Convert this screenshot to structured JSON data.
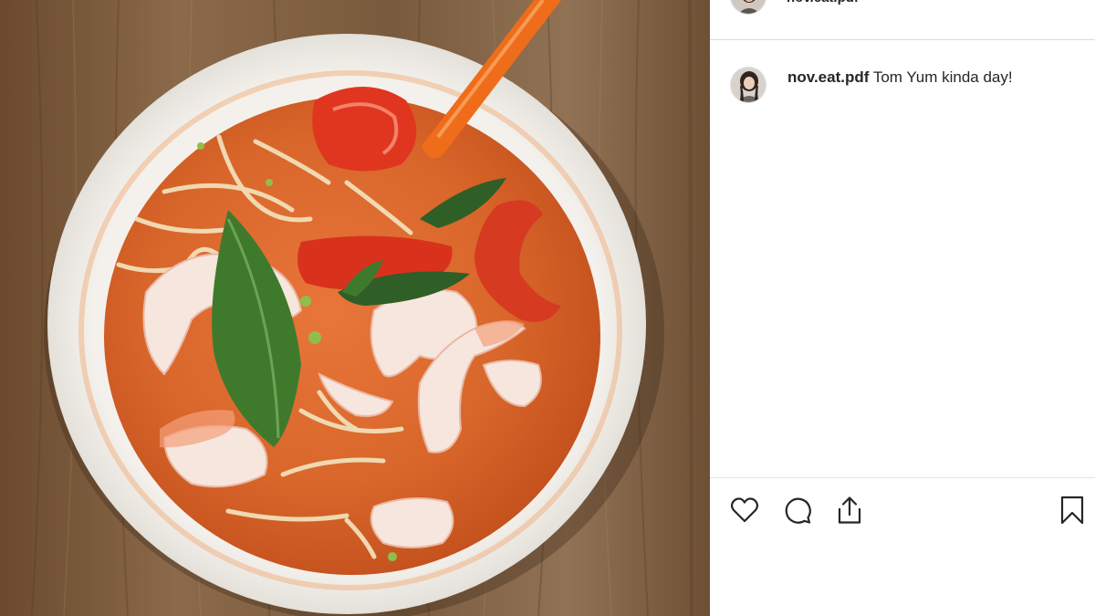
{
  "post": {
    "username": "nov.eat.pdf",
    "header_username": "nov.eat.pdf",
    "caption": "Tom Yum kinda day!"
  },
  "image": {
    "subject": "tom-yum-noodle-soup-bowl"
  },
  "icons": {
    "like": "heart-icon",
    "comment": "comment-icon",
    "share": "share-icon",
    "save": "bookmark-icon"
  },
  "colors": {
    "text": "#262626",
    "border": "#dbdbdb"
  }
}
